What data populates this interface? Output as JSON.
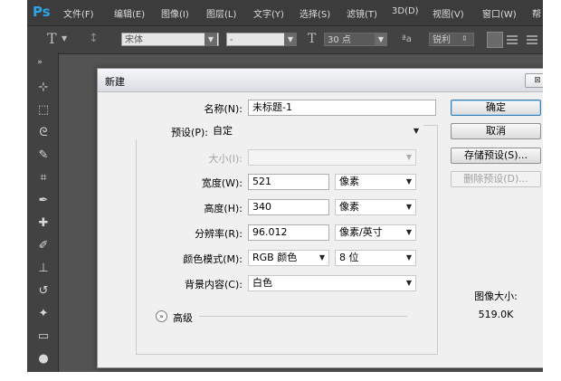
{
  "app": {
    "logo": "Ps"
  },
  "menu": [
    "文件(F)",
    "编辑(E)",
    "图像(I)",
    "图层(L)",
    "文字(Y)",
    "选择(S)",
    "滤镜(T)",
    "3D(D)",
    "视图(V)",
    "窗口(W)",
    "帮"
  ],
  "options_bar": {
    "tool_glyph": "T",
    "font_family": "宋体",
    "font_style": "-",
    "font_size": "30 点",
    "aa_label": "ªa",
    "aa_mode": "锐利"
  },
  "dialog": {
    "title": "新建",
    "close_glyph": "⊠",
    "name_label": "名称(N):",
    "name_value": "未标题-1",
    "preset_label": "预设(P):",
    "preset_value": "自定",
    "size_label": "大小(I):",
    "size_value": "",
    "width_label": "宽度(W):",
    "width_value": "521",
    "width_unit": "像素",
    "height_label": "高度(H):",
    "height_value": "340",
    "height_unit": "像素",
    "resolution_label": "分辨率(R):",
    "resolution_value": "96.012",
    "resolution_unit": "像素/英寸",
    "color_mode_label": "颜色模式(M):",
    "color_mode_value": "RGB 颜色",
    "bit_depth_value": "8 位",
    "background_label": "背景内容(C):",
    "background_value": "白色",
    "advanced_label": "高级",
    "buttons": {
      "ok": "确定",
      "cancel": "取消",
      "save_preset": "存储预设(S)...",
      "delete_preset": "删除预设(D)..."
    },
    "image_size_label": "图像大小:",
    "image_size_value": "519.0K"
  }
}
